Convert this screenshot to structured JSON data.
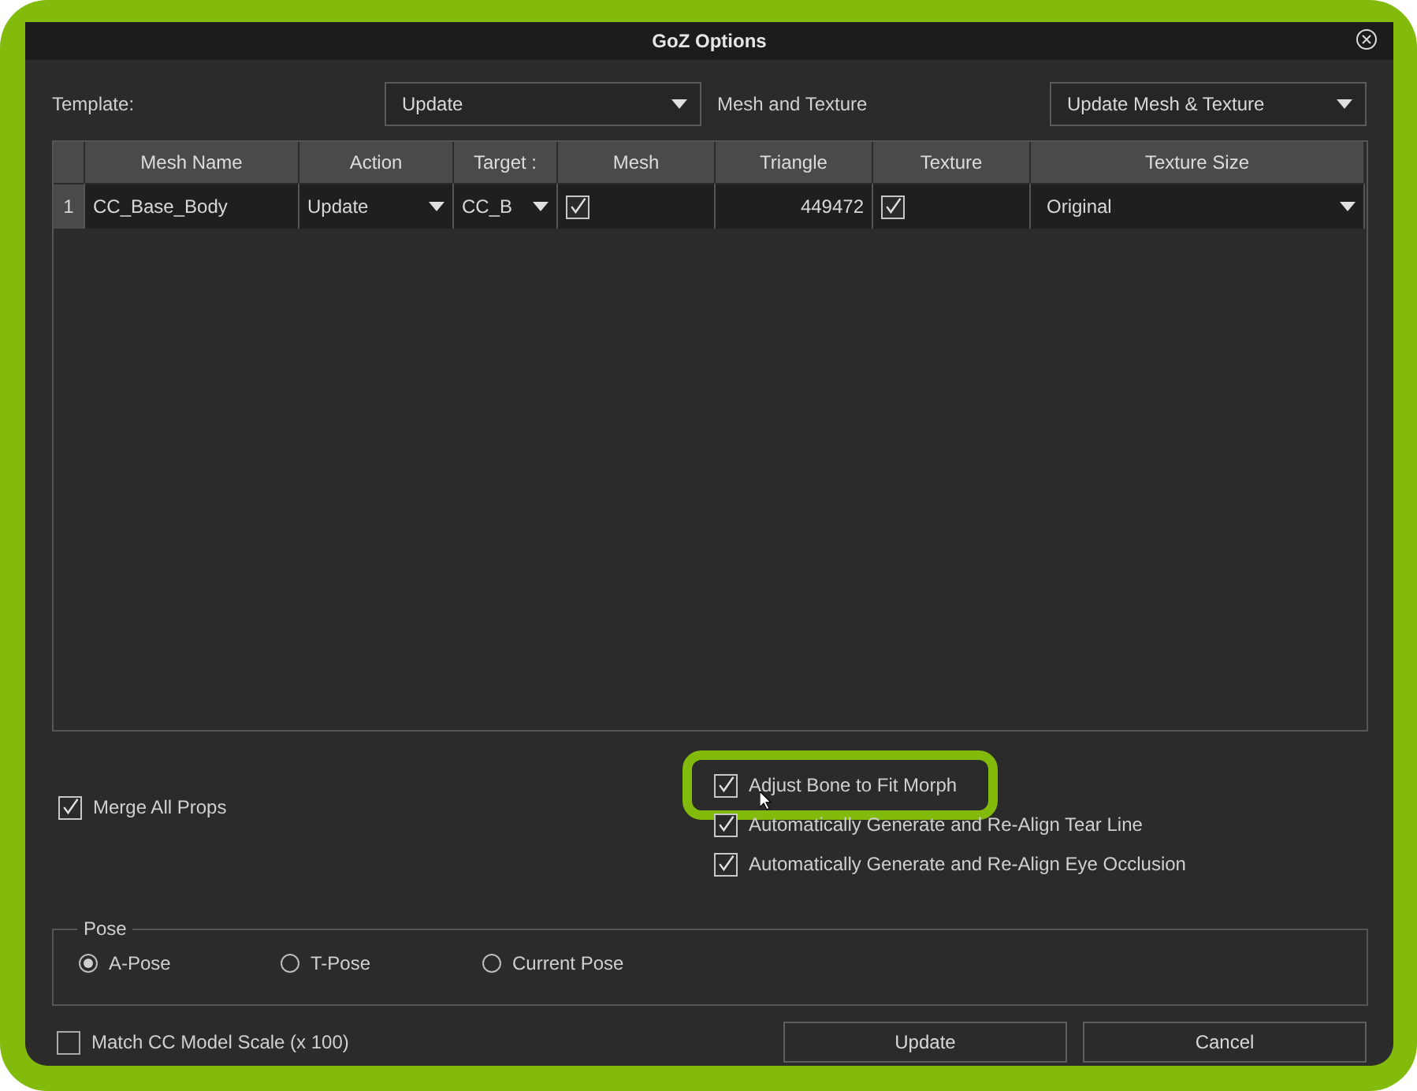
{
  "window": {
    "title": "GoZ Options"
  },
  "template": {
    "label": "Template:",
    "value": "Update"
  },
  "mesh_texture": {
    "label": "Mesh and Texture",
    "value": "Update Mesh & Texture"
  },
  "table": {
    "columns": [
      "Mesh Name",
      "Action",
      "Target :",
      "Mesh",
      "Triangle",
      "Texture",
      "Texture Size"
    ],
    "rows": [
      {
        "index": "1",
        "mesh_name": "CC_Base_Body",
        "action": "Update",
        "target": "CC_B",
        "mesh": true,
        "triangle": "449472",
        "texture": true,
        "texture_size": "Original"
      }
    ]
  },
  "options_left": [
    {
      "label": "Merge All Props",
      "checked": true,
      "highlighted": false
    }
  ],
  "options_right": [
    {
      "label": "Adjust Bone to Fit Morph",
      "checked": true,
      "highlighted": true
    },
    {
      "label": "Automatically Generate and Re-Align Tear Line",
      "checked": true,
      "highlighted": false
    },
    {
      "label": "Automatically Generate and Re-Align Eye Occlusion",
      "checked": true,
      "highlighted": false
    }
  ],
  "pose": {
    "title": "Pose",
    "options": [
      {
        "label": "A-Pose",
        "selected": true
      },
      {
        "label": "T-Pose",
        "selected": false
      },
      {
        "label": "Current Pose",
        "selected": false
      }
    ]
  },
  "match_scale": {
    "label": "Match CC Model Scale (x 100)",
    "checked": false
  },
  "buttons": [
    "Update",
    "Cancel"
  ]
}
